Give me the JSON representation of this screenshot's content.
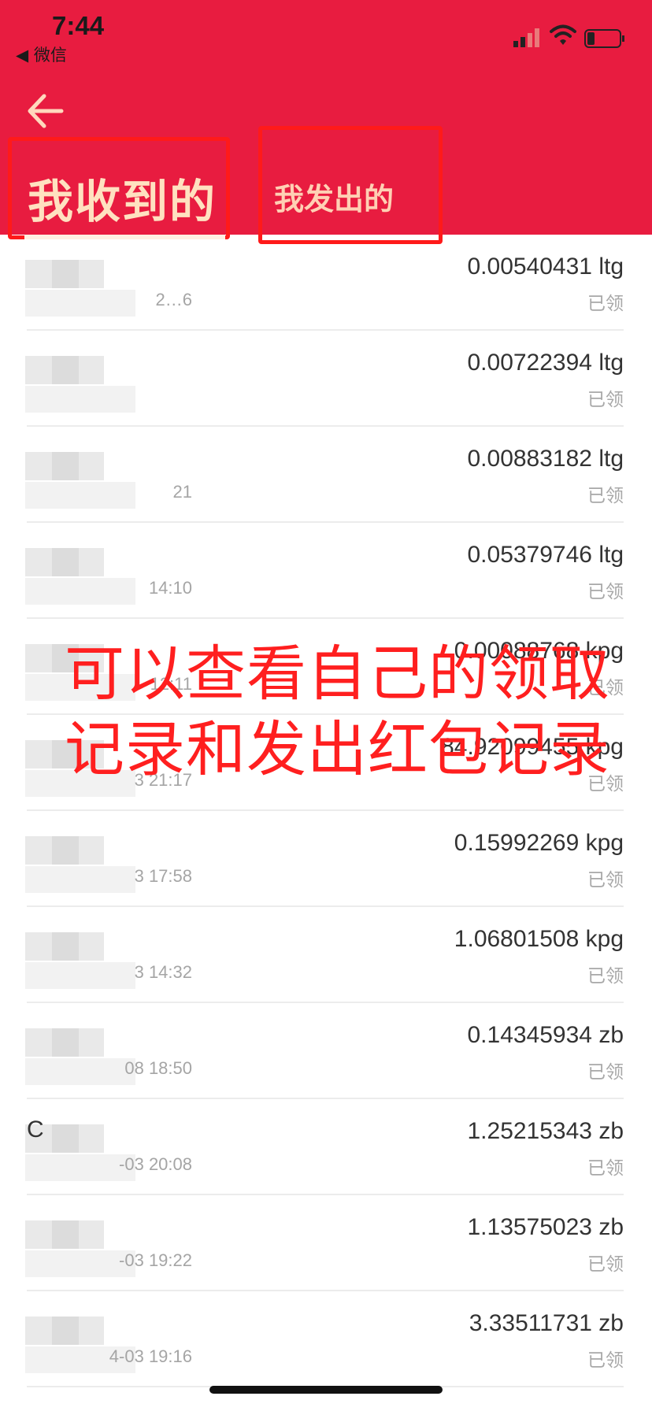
{
  "status_bar": {
    "time": "7:44",
    "back_app": "◀ 微信"
  },
  "tabs": {
    "received": "我收到的",
    "sent": "我发出的"
  },
  "overlay_note": "可以查看自己的领取记录和发出红包记录",
  "records": [
    {
      "lead": "",
      "time": "2…6",
      "amount": "0.00540431 ltg",
      "status": "已领"
    },
    {
      "lead": "",
      "time": "",
      "amount": "0.00722394 ltg",
      "status": "已领"
    },
    {
      "lead": "",
      "time": "21",
      "amount": "0.00883182 ltg",
      "status": "已领"
    },
    {
      "lead": "",
      "time": "14:10",
      "amount": "0.05379746 ltg",
      "status": "已领"
    },
    {
      "lead": "",
      "time": "12:11",
      "amount": "0.00088768 kpg",
      "status": "已领"
    },
    {
      "lead": "",
      "time": "3 21:17",
      "amount": "84.92099455 kpg",
      "status": "已领"
    },
    {
      "lead": "",
      "time": "3 17:58",
      "amount": "0.15992269 kpg",
      "status": "已领"
    },
    {
      "lead": "",
      "time": "3 14:32",
      "amount": "1.06801508 kpg",
      "status": "已领"
    },
    {
      "lead": "",
      "time": "08 18:50",
      "amount": "0.14345934 zb",
      "status": "已领"
    },
    {
      "lead": "C",
      "time": "-03 20:08",
      "amount": "1.25215343 zb",
      "status": "已领"
    },
    {
      "lead": "",
      "time": "-03 19:22",
      "amount": "1.13575023 zb",
      "status": "已领"
    },
    {
      "lead": "",
      "time": "4-03 19:16",
      "amount": "3.33511731 zb",
      "status": "已领"
    }
  ],
  "colors": {
    "header": "#e81c40",
    "annotation": "#ff1f1f",
    "tab_text": "#ffe1c0"
  },
  "icons": {
    "back": "arrow-left-icon",
    "signal": "cellular-signal-icon",
    "wifi": "wifi-icon",
    "battery": "battery-icon"
  }
}
